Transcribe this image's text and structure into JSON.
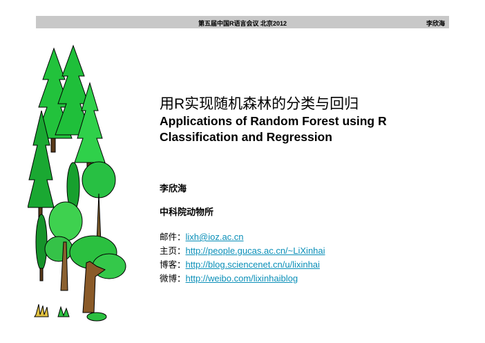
{
  "header": {
    "center": "第五届中国R语言会议 北京2012",
    "right": "李欣海"
  },
  "title": {
    "line_cn": "用R实现随机森林的分类与回归",
    "line_en_1": "Applications of Random Forest using R",
    "line_en_2": "Classification and Regression"
  },
  "author": "李欣海",
  "affiliation": "中科院动物所",
  "contacts": [
    {
      "label": "邮件：",
      "value": "lixh@ioz.ac.cn"
    },
    {
      "label": "主页：",
      "value": "http://people.gucas.ac.cn/~LiXinhai"
    },
    {
      "label": "博客：",
      "value": "http://blog.sciencenet.cn/u/lixinhai"
    },
    {
      "label": "微博：",
      "value": "http://weibo.com/lixinhaiblog"
    }
  ],
  "colors": {
    "header_bg": "#c8c8c8",
    "link": "#0a8fb8",
    "tree_green": "#1fbf3a"
  }
}
